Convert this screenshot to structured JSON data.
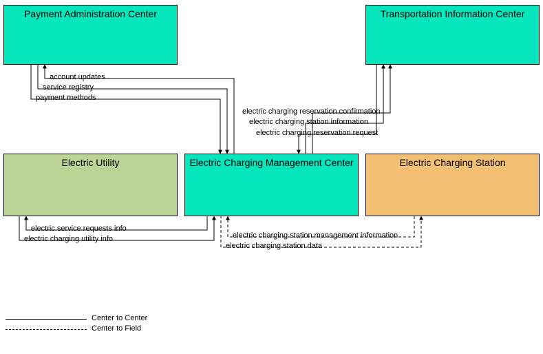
{
  "boxes": {
    "payment_admin": {
      "label": "Payment Administration Center",
      "color": "#05e6bc"
    },
    "transport_info": {
      "label": "Transportation Information Center",
      "color": "#05e6bc"
    },
    "electric_utility": {
      "label": "Electric Utility",
      "color": "#bcd396"
    },
    "charging_mgmt": {
      "label": "Electric Charging Management Center",
      "color": "#05e6bc"
    },
    "charging_station": {
      "label": "Electric Charging Station",
      "color": "#f2bf73"
    }
  },
  "flows": {
    "pa_top": "account updates",
    "pa_mid": "service registry",
    "pa_bot": "payment methods",
    "ti_top": "electric charging reservation confirmation",
    "ti_mid": "electric charging station information",
    "ti_bot": "electric charging reservation request",
    "eu_top": "electric service requests info",
    "eu_bot": "electric charging utility info",
    "cs_top": "electric charging station management information",
    "cs_bot": "electric charging station data"
  },
  "legend": {
    "c2c": "Center to Center",
    "c2f": "Center to Field"
  }
}
